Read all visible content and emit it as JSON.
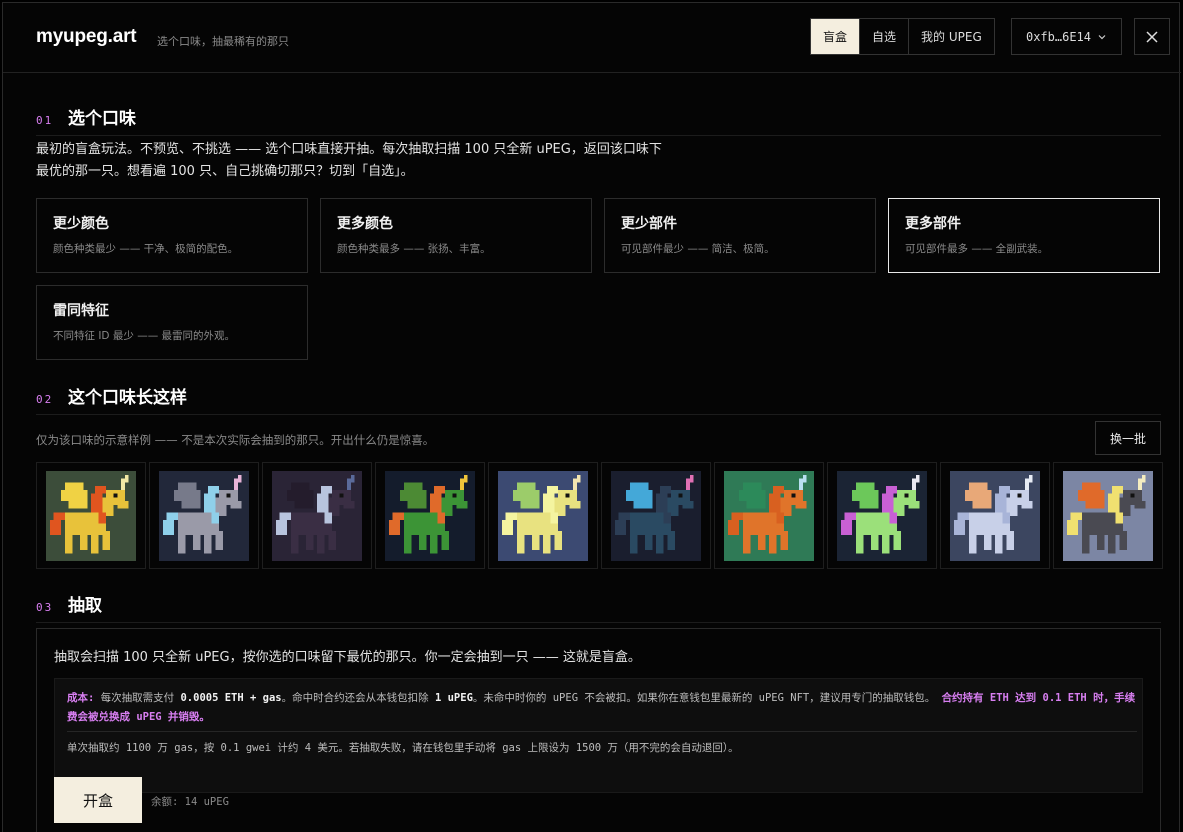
{
  "header": {
    "logo": "myupeg.art",
    "tagline": "选个口味，抽最稀有的那只",
    "tabs": [
      "盲盒",
      "自选",
      "我的 UPEG"
    ],
    "active_tab": 0,
    "wallet": "0xfb…6E14",
    "wallet_icon": "chevron-down-icon",
    "close_icon": "close-icon"
  },
  "section1": {
    "num": "01",
    "title": "选个口味",
    "desc_line1": "最初的盲盒玩法。不预览、不挑选 —— 选个口味直接开抽。每次抽取扫描 100 只全新 uPEG，返回该口味下",
    "desc_line2": "最优的那一只。想看遍 100 只、自己挑确切那只？切到「自选」。",
    "flavors": [
      {
        "title": "更少颜色",
        "sub": "颜色种类最少 —— 干净、极简的配色。",
        "selected": false
      },
      {
        "title": "更多颜色",
        "sub": "颜色种类最多 —— 张扬、丰富。",
        "selected": false
      },
      {
        "title": "更少部件",
        "sub": "可见部件最少 —— 简洁、极简。",
        "selected": false
      },
      {
        "title": "更多部件",
        "sub": "可见部件最多 —— 全副武装。",
        "selected": true
      },
      {
        "title": "雷同特征",
        "sub": "不同特征 ID 最少 —— 最雷同的外观。",
        "selected": false
      }
    ]
  },
  "section2": {
    "num": "02",
    "title": "这个口味长这样",
    "note": "仅为该口味的示意样例 —— 不是本次实际会抽到的那只。开出什么仍是惊喜。",
    "refresh": "换一批",
    "samples": [
      {
        "bg": "#3c4d3a",
        "body": "#e8c23a",
        "mane": "#e0551f",
        "wing": "#f0d244",
        "horn": "#f2e9a6"
      },
      {
        "bg": "#22283a",
        "body": "#9a9aa8",
        "mane": "#8fd0ea",
        "wing": "#777a8a",
        "horn": "#e8b4d8"
      },
      {
        "bg": "#2a2436",
        "body": "#3a2e44",
        "mane": "#b8c4de",
        "wing": "#241c2c",
        "horn": "#5a6a9a"
      },
      {
        "bg": "#141c2c",
        "body": "#3c9436",
        "mane": "#e06a2a",
        "wing": "#4c8a34",
        "horn": "#f0c43a"
      },
      {
        "bg": "#3c4a72",
        "body": "#e8e280",
        "mane": "#f4f4a0",
        "wing": "#9ccc6a",
        "horn": "#f2e4b0"
      },
      {
        "bg": "#1a1e2e",
        "body": "#2a4a62",
        "mane": "#2c3e56",
        "wing": "#44a8d8",
        "horn": "#e070b4"
      },
      {
        "bg": "#2f7a56",
        "body": "#e0742a",
        "mane": "#d86020",
        "wing": "#2c8a5a",
        "horn": "#b8e0f0"
      },
      {
        "bg": "#1b2434",
        "body": "#9be07a",
        "mane": "#c860d4",
        "wing": "#6cc85a",
        "horn": "#e8e8f0"
      },
      {
        "bg": "#3c4660",
        "body": "#c8d0e8",
        "mane": "#a8b4d8",
        "wing": "#e8a878",
        "horn": "#e8ecf4"
      },
      {
        "bg": "#7c86a4",
        "body": "#4a4a52",
        "mane": "#f0e070",
        "wing": "#e06a2a",
        "horn": "#f4ecc0"
      }
    ]
  },
  "section3": {
    "num": "03",
    "title": "抽取",
    "intro": "抽取会扫描 100 只全新 uPEG，按你选的口味留下最优的那只。你一定会抽到一只 —— 这就是盲盒。",
    "cost_label": "成本:",
    "cost_a": " 每次抽取需支付 ",
    "cost_b": "0.0005 ETH + gas",
    "cost_c": "。命中时合约还会从本钱包扣除 ",
    "cost_d": "1 uPEG",
    "cost_e": "。未命中时你的 uPEG 不会被扣。如果你在意钱包里最新的 uPEG NFT，建议用专门的抽取钱包。 ",
    "cost_warn": "合约持有 ETH 达到 0.1 ETH 时，手续费会被兑换成 uPEG 并销毁。",
    "cost_line2": "单次抽取约 1100 万 gas，按 0.1 gwei 计约 4 美元。若抽取失败，请在钱包里手动将 gas 上限设为 1500 万（用不完的会自动退回）。",
    "open_btn": "开盒",
    "balance": "余额: 14 uPEG"
  }
}
